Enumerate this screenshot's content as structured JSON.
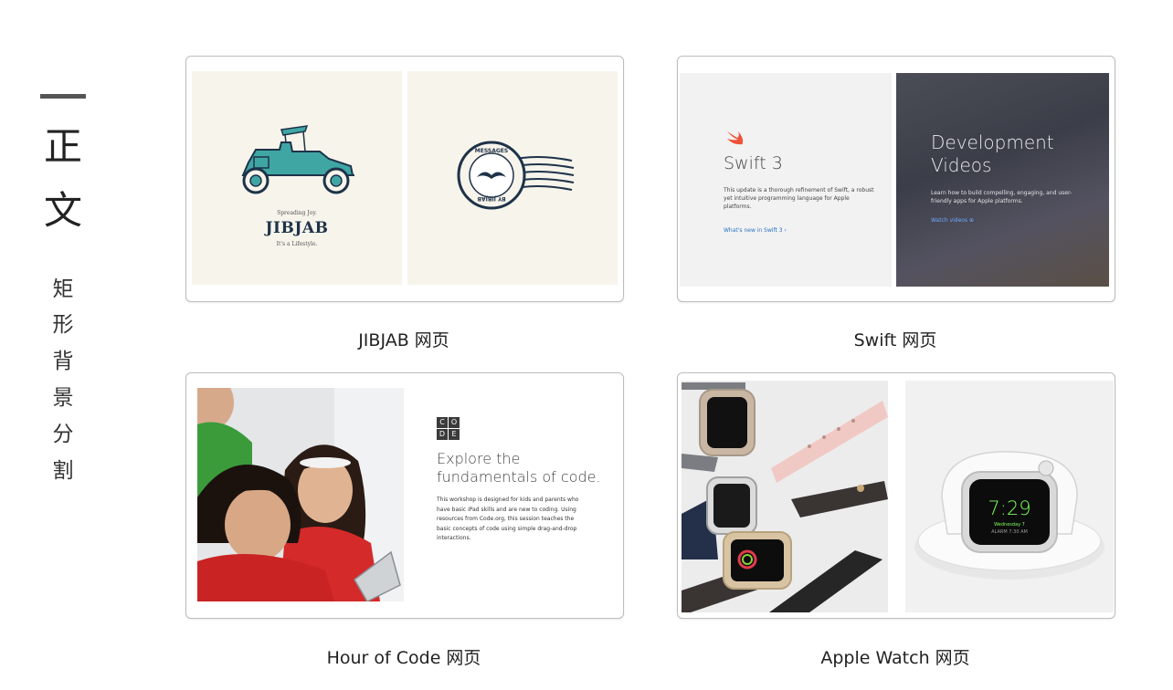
{
  "sidebar": {
    "chars_large": [
      "正",
      "文"
    ],
    "chars_small": [
      "矩",
      "形",
      "背",
      "景",
      "分",
      "割"
    ]
  },
  "cards": {
    "jibjab": {
      "caption": "JIBJAB 网页",
      "tagline": "Spreading Joy.",
      "logo_text": "JIBJAB",
      "subtag": "It's a Lifestyle.",
      "stamp_top": "MESSAGES",
      "stamp_bottom": "BY JIBJAB"
    },
    "swift": {
      "caption": "Swift 网页",
      "title": "Swift 3",
      "desc": "This update is a thorough refinement of Swift, a robust yet intuitive programming language for Apple platforms.",
      "link": "What's new in Swift 3 ›",
      "video_title": "Development Videos",
      "video_desc": "Learn how to build compelling, engaging, and user-friendly apps for Apple platforms.",
      "video_link": "Watch videos ⊕"
    },
    "hour_of_code": {
      "caption": "Hour of Code  网页",
      "logo_letters": [
        "C",
        "O",
        "D",
        "E"
      ],
      "title": "Explore the fundamentals of code.",
      "desc": "This workshop is designed for kids and parents who have basic iPad skills and are new to coding. Using resources from Code.org, this session teaches the basic concepts of code using simple drag-and-drop interactions."
    },
    "apple_watch": {
      "caption": "Apple Watch 网页",
      "watch_time": "7:29",
      "watch_date": "Wednesday 7",
      "watch_alarm": "ALARM 7:30 AM"
    }
  },
  "colors": {
    "jibjab_bg": "#f7f4ec",
    "car_teal": "#3fa6a4",
    "navy": "#1e3348",
    "swift_orange": "#f05138",
    "link_blue": "#2a73c4",
    "watch_green": "#7cff5a"
  }
}
